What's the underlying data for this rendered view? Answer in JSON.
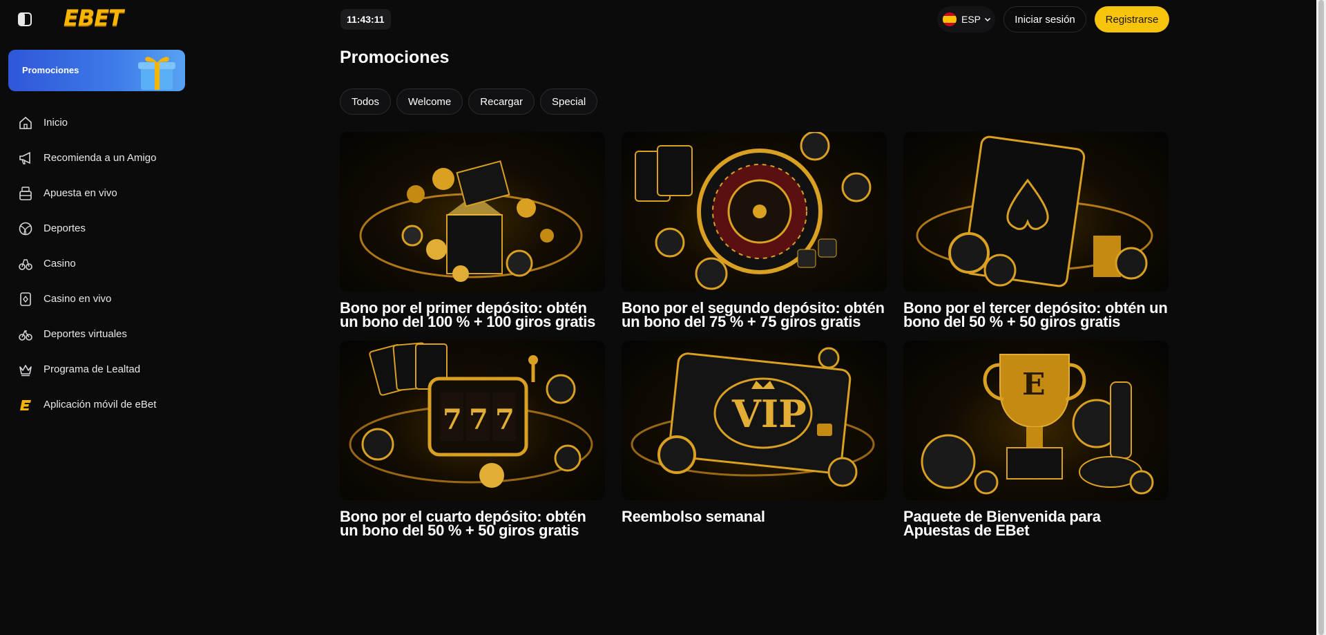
{
  "header": {
    "clock": "11:43:11",
    "language": "ESP",
    "login_label": "Iniciar sesión",
    "register_label": "Registrarse"
  },
  "brand": {
    "logo_text": "EBET"
  },
  "sidebar": {
    "promo_banner_label": "Promociones",
    "items": [
      {
        "label": "Inicio",
        "icon": "home-icon"
      },
      {
        "label": "Recomienda a un Amigo",
        "icon": "megaphone-icon"
      },
      {
        "label": "Apuesta en vivo",
        "icon": "live-bet-icon"
      },
      {
        "label": "Deportes",
        "icon": "ball-icon"
      },
      {
        "label": "Casino",
        "icon": "casino-icon"
      },
      {
        "label": "Casino en vivo",
        "icon": "card-icon"
      },
      {
        "label": "Deportes virtuales",
        "icon": "virtual-sports-icon"
      },
      {
        "label": "Programa de Lealtad",
        "icon": "crown-icon"
      },
      {
        "label": "Aplicación móvil de eBet",
        "icon": "ebet-app-icon"
      }
    ]
  },
  "main": {
    "title": "Promociones",
    "filters": [
      "Todos",
      "Welcome",
      "Recargar",
      "Special"
    ],
    "promotions": [
      {
        "title": "Bono por el primer depósito: obtén un bono del 100 % + 100 giros gratis",
        "image": "gift-coins"
      },
      {
        "title": "Bono por el segundo depósito: obtén un bono del 75 % + 75 giros gratis",
        "image": "roulette"
      },
      {
        "title": "Bono por el tercer depósito: obtén un bono del 50 % + 50 giros gratis",
        "image": "ace-spades"
      },
      {
        "title": "Bono por el cuarto depósito: obtén un bono del 50 % + 50 giros gratis",
        "image": "slot-777"
      },
      {
        "title": "Reembolso semanal",
        "image": "vip-card"
      },
      {
        "title": "Paquete de Bienvenida para Apuestas de EBet",
        "image": "trophy"
      }
    ]
  },
  "colors": {
    "background": "#0b0b0c",
    "accent": "#f7c40c",
    "promo_blue": "#3d7be8",
    "gold": "#d9a021"
  }
}
